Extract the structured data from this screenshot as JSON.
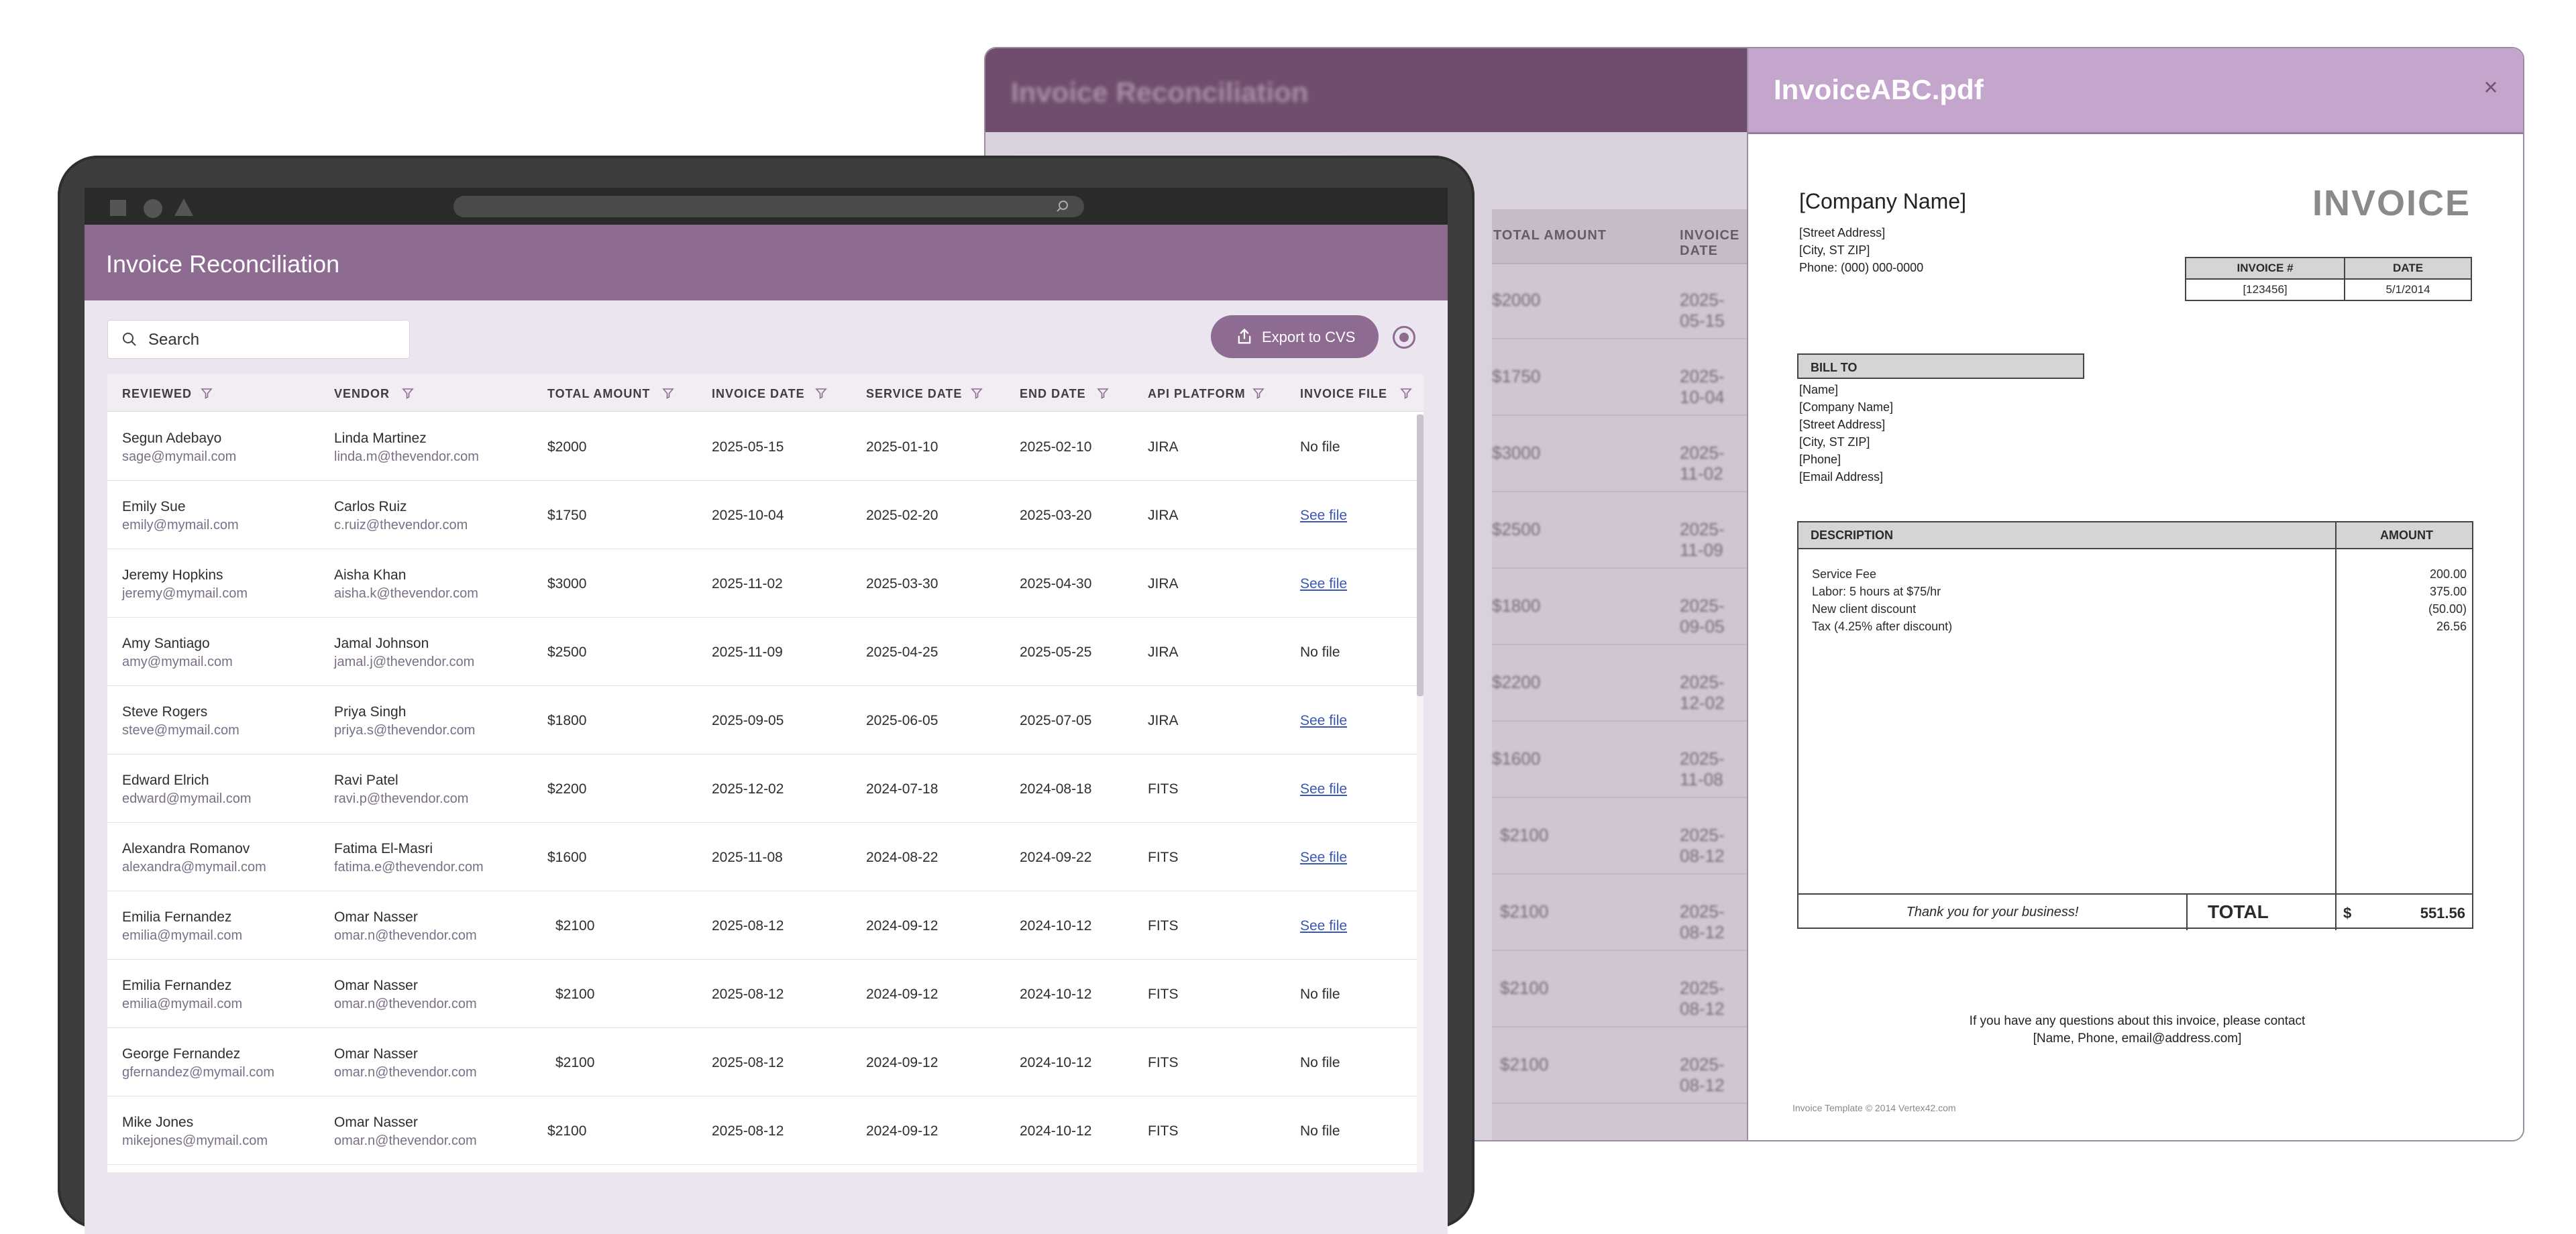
{
  "back_window": {
    "app_title": "Invoice Reconciliation",
    "table_headers": [
      "TOTAL AMOUNT",
      "INVOICE DATE"
    ],
    "amounts": [
      "$2000",
      "$1750",
      "$3000",
      "$2500",
      "$1800",
      "$2200",
      "$1600",
      "$2100",
      "$2100",
      "$2100",
      "$2100"
    ],
    "dates": [
      "2025-05-15",
      "2025-10-04",
      "2025-11-02",
      "2025-11-09",
      "2025-09-05",
      "2025-12-02",
      "2025-11-08",
      "2025-08-12",
      "2025-08-12",
      "2025-08-12",
      "2025-08-12"
    ]
  },
  "pdf": {
    "filename": "InvoiceABC.pdf",
    "close_glyph": "×",
    "company": "[Company Name]",
    "invoice_word": "INVOICE",
    "address_lines": [
      "[Street Address]",
      "[City, ST  ZIP]",
      "Phone: (000) 000-0000"
    ],
    "meta_headers": [
      "INVOICE #",
      "DATE"
    ],
    "meta_values": [
      "[123456]",
      "5/1/2014"
    ],
    "bill_to_label": "BILL TO",
    "bill_to_lines": [
      "[Name]",
      "[Company Name]",
      "[Street Address]",
      "[City, ST  ZIP]",
      "[Phone]",
      "[Email Address]"
    ],
    "items_headers": [
      "DESCRIPTION",
      "AMOUNT"
    ],
    "items": [
      {
        "desc": "Service Fee",
        "amount": "200.00"
      },
      {
        "desc": "Labor: 5 hours at $75/hr",
        "amount": "375.00"
      },
      {
        "desc": "New client discount",
        "amount": "(50.00)"
      },
      {
        "desc": "Tax (4.25% after discount)",
        "amount": "26.56"
      }
    ],
    "thanks": "Thank you for your business!",
    "total_label": "TOTAL",
    "currency": "$",
    "total_value": "551.56",
    "contact_lines": [
      "If you have any questions about this invoice, please contact",
      "[Name, Phone, email@address.com]"
    ],
    "credit": "Invoice Template © 2014 Vertex42.com"
  },
  "app": {
    "title": "Invoice Reconciliation",
    "search_placeholder": "Search",
    "export_label": "Export to CVS",
    "columns": [
      "REVIEWED",
      "VENDOR",
      "TOTAL AMOUNT",
      "INVOICE DATE",
      "SERVICE DATE",
      "END DATE",
      "API PLATFORM",
      "INVOICE FILE"
    ],
    "rows": [
      {
        "reviewer": "Segun Adebayo",
        "reviewer_email": "sage@mymail.com",
        "vendor": "Linda Martinez",
        "vendor_email": "linda.m@thevendor.com",
        "amount": "$2000",
        "invoice_date": "2025-05-15",
        "service_date": "2025-01-10",
        "end_date": "2025-02-10",
        "platform": "JIRA",
        "file": "No file",
        "has_file": false
      },
      {
        "reviewer": "Emily Sue",
        "reviewer_email": "emily@mymail.com",
        "vendor": "Carlos Ruiz",
        "vendor_email": "c.ruiz@thevendor.com",
        "amount": "$1750",
        "invoice_date": "2025-10-04",
        "service_date": "2025-02-20",
        "end_date": "2025-03-20",
        "platform": "JIRA",
        "file": "See file",
        "has_file": true
      },
      {
        "reviewer": "Jeremy Hopkins",
        "reviewer_email": "jeremy@mymail.com",
        "vendor": "Aisha Khan",
        "vendor_email": "aisha.k@thevendor.com",
        "amount": "$3000",
        "invoice_date": "2025-11-02",
        "service_date": "2025-03-30",
        "end_date": "2025-04-30",
        "platform": "JIRA",
        "file": "See file",
        "has_file": true
      },
      {
        "reviewer": "Amy Santiago",
        "reviewer_email": "amy@mymail.com",
        "vendor": "Jamal Johnson",
        "vendor_email": "jamal.j@thevendor.com",
        "amount": "$2500",
        "invoice_date": "2025-11-09",
        "service_date": "2025-04-25",
        "end_date": "2025-05-25",
        "platform": "JIRA",
        "file": "No file",
        "has_file": false
      },
      {
        "reviewer": "Steve Rogers",
        "reviewer_email": "steve@mymail.com",
        "vendor": "Priya Singh",
        "vendor_email": "priya.s@thevendor.com",
        "amount": "$1800",
        "invoice_date": "2025-09-05",
        "service_date": "2025-06-05",
        "end_date": "2025-07-05",
        "platform": "JIRA",
        "file": "See file",
        "has_file": true
      },
      {
        "reviewer": "Edward Elrich",
        "reviewer_email": "edward@mymail.com",
        "vendor": "Ravi Patel",
        "vendor_email": "ravi.p@thevendor.com",
        "amount": "$2200",
        "invoice_date": "2025-12-02",
        "service_date": "2024-07-18",
        "end_date": "2024-08-18",
        "platform": "FITS",
        "file": "See file",
        "has_file": true
      },
      {
        "reviewer": "Alexandra Romanov",
        "reviewer_email": "alexandra@mymail.com",
        "vendor": "Fatima El-Masri",
        "vendor_email": "fatima.e@thevendor.com",
        "amount": "$1600",
        "invoice_date": "2025-11-08",
        "service_date": "2024-08-22",
        "end_date": "2024-09-22",
        "platform": "FITS",
        "file": "See file",
        "has_file": true
      },
      {
        "reviewer": "Emilia Fernandez",
        "reviewer_email": "emilia@mymail.com",
        "vendor": "Omar Nasser",
        "vendor_email": "omar.n@thevendor.com",
        "amount": "$2100",
        "invoice_date": "2025-08-12",
        "service_date": "2024-09-12",
        "end_date": "2024-10-12",
        "platform": "FITS",
        "file": "See file",
        "has_file": true
      },
      {
        "reviewer": "Emilia Fernandez",
        "reviewer_email": "emilia@mymail.com",
        "vendor": "Omar Nasser",
        "vendor_email": "omar.n@thevendor.com",
        "amount": "$2100",
        "invoice_date": "2025-08-12",
        "service_date": "2024-09-12",
        "end_date": "2024-10-12",
        "platform": "FITS",
        "file": "No file",
        "has_file": false
      },
      {
        "reviewer": "George Fernandez",
        "reviewer_email": "gfernandez@mymail.com",
        "vendor": "Omar Nasser",
        "vendor_email": "omar.n@thevendor.com",
        "amount": "$2100",
        "invoice_date": "2025-08-12",
        "service_date": "2024-09-12",
        "end_date": "2024-10-12",
        "platform": "FITS",
        "file": "No file",
        "has_file": false
      },
      {
        "reviewer": "Mike Jones",
        "reviewer_email": "mikejones@mymail.com",
        "vendor": "Omar Nasser",
        "vendor_email": "omar.n@thevendor.com",
        "amount": "$2100",
        "invoice_date": "2025-08-12",
        "service_date": "2024-09-12",
        "end_date": "2024-10-12",
        "platform": "FITS",
        "file": "No file",
        "has_file": false
      }
    ]
  },
  "colors": {
    "brand": "#8e6b90",
    "pdf_header": "#c4a5cc",
    "link": "#3a56b6"
  },
  "icons": [
    "search-icon",
    "export-icon",
    "filter-icon",
    "close-icon",
    "settings-radio-icon"
  ]
}
